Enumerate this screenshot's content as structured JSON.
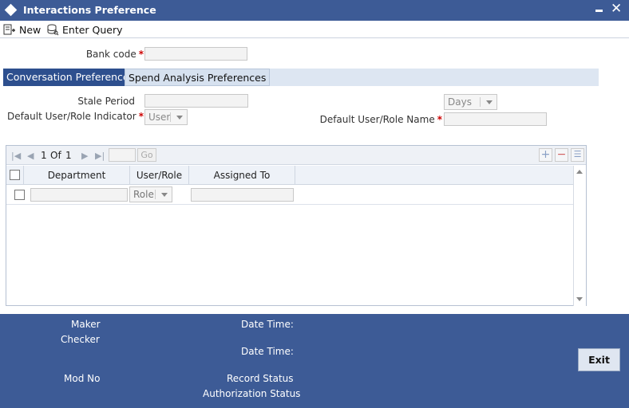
{
  "window": {
    "title": "Interactions Preference"
  },
  "toolbar": {
    "new_label": "New",
    "enter_query_label": "Enter Query"
  },
  "form": {
    "bank_code_label": "Bank code",
    "bank_code_value": "",
    "required_mark": "*"
  },
  "tabs": [
    {
      "label": "Conversation Preferences",
      "active": true
    },
    {
      "label": "Spend Analysis Preferences",
      "active": false
    }
  ],
  "conversation": {
    "stale_period_label": "Stale Period",
    "stale_period_value": "",
    "stale_unit": "Days",
    "default_indicator_label": "Default User/Role Indicator",
    "default_indicator_value": "User",
    "default_name_label": "Default User/Role Name",
    "default_name_value": ""
  },
  "grid": {
    "page_current": "1",
    "page_of": "Of",
    "page_total": "1",
    "go_label": "Go",
    "columns": [
      "Department",
      "User/Role",
      "Assigned To"
    ],
    "rows": [
      {
        "department": "",
        "user_role": "Role",
        "assigned_to": ""
      }
    ]
  },
  "footer": {
    "maker_label": "Maker",
    "checker_label": "Checker",
    "date_time_label": "Date Time:",
    "mod_no_label": "Mod No",
    "record_status_label": "Record Status",
    "authorization_status_label": "Authorization Status",
    "exit_label": "Exit"
  },
  "colors": {
    "title_bar": "#3d5b96",
    "active_tab": "#2d4f8e",
    "required": "#cc0000"
  }
}
